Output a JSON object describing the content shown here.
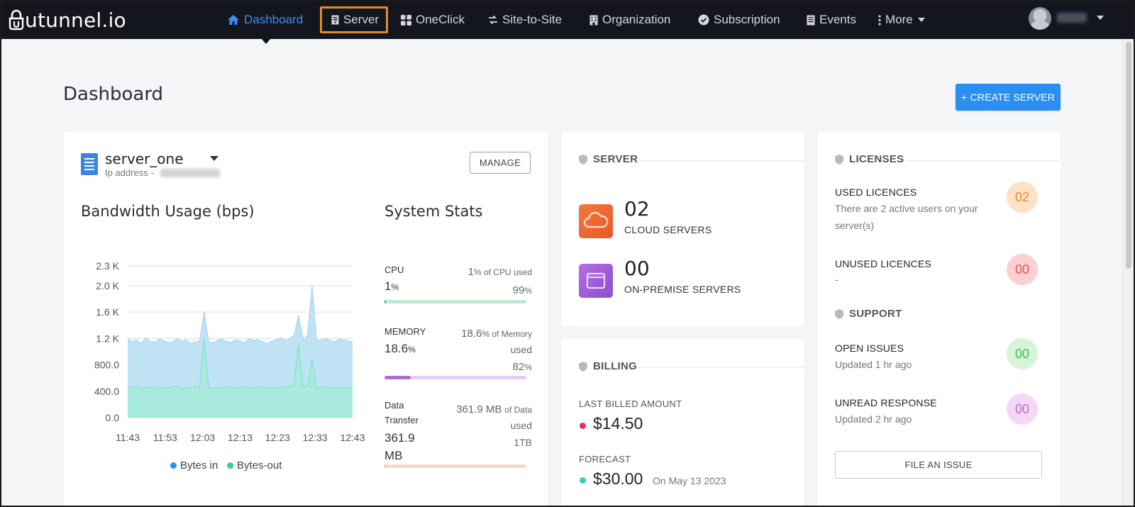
{
  "brand": {
    "logo_text": "utunnel.io"
  },
  "nav": {
    "items": [
      {
        "label": "Dashboard",
        "icon": "home-icon",
        "active": true
      },
      {
        "label": "Server",
        "icon": "server-icon",
        "highlighted": true
      },
      {
        "label": "OneClick",
        "icon": "grid-icon"
      },
      {
        "label": "Site-to-Site",
        "icon": "swap-icon"
      },
      {
        "label": "Organization",
        "icon": "building-icon"
      },
      {
        "label": "Subscription",
        "icon": "check-circle-icon"
      },
      {
        "label": "Events",
        "icon": "calendar-icon"
      },
      {
        "label": "More",
        "icon": "more-vertical-icon"
      }
    ]
  },
  "page": {
    "title": "Dashboard",
    "create_button": "+ CREATE SERVER"
  },
  "server_card": {
    "name": "server_one",
    "ip_label": "Ip address -",
    "manage_button": "MANAGE",
    "bandwidth_title": "Bandwidth Usage (bps)",
    "stats_title": "System Stats"
  },
  "chart_data": {
    "type": "area",
    "title": "Bandwidth Usage (bps)",
    "x_ticks": [
      "11:43",
      "11:53",
      "12:03",
      "12:13",
      "12:23",
      "12:33",
      "12:43"
    ],
    "y_ticks": [
      "0.0",
      "400.0",
      "800.0",
      "1.2 K",
      "1.6 K",
      "2.0 K",
      "2.3 K"
    ],
    "ylim": [
      0,
      2300
    ],
    "legend_position": "bottom",
    "series": [
      {
        "name": "Bytes in",
        "color": "#2a8fe8",
        "values": [
          1200,
          1150,
          1180,
          1120,
          1210,
          1160,
          1140,
          1190,
          1170,
          1130,
          1150,
          1200,
          1160,
          1180,
          1120,
          1150,
          1160,
          1600,
          1150,
          1130,
          1170,
          1190,
          1150,
          1140,
          1180,
          1160,
          1130,
          1200,
          1170,
          1180,
          1150,
          1120,
          1160,
          1180,
          1210,
          1170,
          1190,
          1250,
          1550,
          1180,
          1250,
          2000,
          1160,
          1180,
          1200,
          1170,
          1150,
          1190,
          1180,
          1160,
          1150
        ]
      },
      {
        "name": "Bytes-out",
        "color": "#2fd39a",
        "values": [
          480,
          450,
          470,
          440,
          460,
          455,
          470,
          445,
          460,
          450,
          465,
          470,
          440,
          455,
          460,
          470,
          450,
          1200,
          450,
          455,
          460,
          445,
          470,
          455,
          450,
          465,
          460,
          440,
          455,
          460,
          470,
          450,
          455,
          460,
          450,
          465,
          470,
          500,
          1100,
          460,
          480,
          880,
          450,
          455,
          470,
          460,
          450,
          455,
          460,
          450,
          455
        ]
      }
    ]
  },
  "stats": {
    "cpu": {
      "label": "CPU",
      "value": "1",
      "unit": "%",
      "right_num": "1",
      "right_text": "% of CPU used",
      "free_num": "99",
      "free_unit": "%",
      "used_fraction": 0.01,
      "track_color": "#bfe9d1",
      "fill_color": "#2fbf75"
    },
    "memory": {
      "label": "MEMORY",
      "value": "18.6",
      "unit": "%",
      "right_num": "18.6",
      "right_text": "% of Memory",
      "right_text2": "used",
      "free_num": "82",
      "free_unit": "%",
      "used_fraction": 0.186,
      "track_color": "#e6cdf1",
      "fill_color": "#b36ad1"
    },
    "transfer": {
      "label": "Data",
      "label2": "Transfer",
      "value": "361.9",
      "value2": "MB",
      "right_num": "361.9 MB",
      "right_text": "of Data",
      "right_text2": "used",
      "limit": "1TB",
      "used_fraction": 0.0004,
      "track_color": "#f7d7c8",
      "fill_color": "#ef9a73"
    }
  },
  "server_summary": {
    "heading": "SERVER",
    "cloud_count": "02",
    "cloud_label": "CLOUD SERVERS",
    "onprem_count": "00",
    "onprem_label": "ON-PREMISE SERVERS"
  },
  "billing": {
    "heading": "BILLING",
    "last_label": "LAST BILLED AMOUNT",
    "last_amount": "$14.50",
    "forecast_label": "FORECAST",
    "forecast_amount": "$30.00",
    "forecast_date": "On May 13 2023"
  },
  "licenses": {
    "heading": "LICENSES",
    "used_title": "USED LICENCES",
    "used_sub1": "There are 2 active users on your",
    "used_sub2": "server(s)",
    "used_count": "02",
    "unused_title": "UNUSED LICENCES",
    "unused_sub": "-",
    "unused_count": "00"
  },
  "support": {
    "heading": "SUPPORT",
    "open_title": "OPEN ISSUES",
    "open_sub": "Updated 1 hr ago",
    "open_count": "00",
    "unread_title": "UNREAD RESPONSE",
    "unread_sub": "Updated 2 hr ago",
    "unread_count": "00",
    "file_button": "FILE AN ISSUE"
  }
}
